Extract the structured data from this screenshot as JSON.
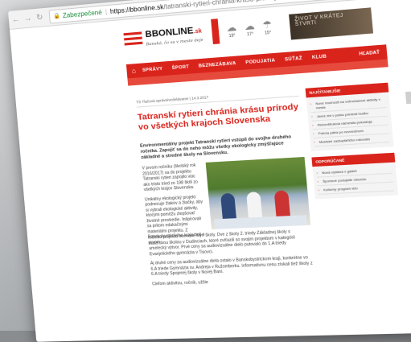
{
  "browser": {
    "secure_label": "Zabezpečené",
    "url_host": "https://bbonline.sk",
    "url_path": "/tatranski-rytieri-chrania-krasu-prirody-vo-vsetkych-krajoch-slovenska/"
  },
  "site": {
    "logo_main": "BBONLINE",
    "logo_suffix": ".sk",
    "tagline": "Banská, čo sa v meste deje",
    "banner_text": "ŽIVOT V KRÁTEJ ŠTVRTI",
    "weather": [
      {
        "icon": "cloud-sun-icon",
        "temp": "19°"
      },
      {
        "icon": "cloud-icon",
        "temp": "17°"
      },
      {
        "icon": "rain-icon",
        "temp": "15°"
      }
    ]
  },
  "nav": {
    "items": [
      "SPRÁVY",
      "ŠPORT",
      "BEZNEZÁBAVA",
      "PODUJATIA",
      "SÚŤAŽ",
      "KLUB"
    ],
    "search_label": "HĽADAŤ"
  },
  "article": {
    "breadcrumb": "TS Tlačová správa/vzdelávanie | 14.3.2017",
    "title": "Tatranskí rytieri chránia krásu prírody vo všetkých krajoch Slovenska",
    "lead": "Environmentálny projekt Tatranskí rytieri vstúpil do svojho druhého ročníka. Zapojiť sa do neho môžu všetky ekologicky zmýšľajúce základné a stredné školy na Slovensku.",
    "p1": "V prvom ročníku (školský rok 2016/2017) sa do projektu Tatranskí rytieri zapojilo viac ako tristo tried zo 198 škôl zo všetkých krajov Slovenska.",
    "p2": "Unikátny ekologický projekt podnecuje žiakov a žiačky, aby si vybrali ekologické aktivity, ktorými pomôžu zlepšovať životné prostredie. Inšpirovali sa pritom edukačnými materiálmi projektu. Z Banskobystrického kraja boli v prvom",
    "p3": "ročníku projektu ocenené štyri školy. Dve z školy 2. triedy Základnej školy s materskou školou v Dudinciach, ktoré zvíťazili so svojim projektom v kategórii umelecký výtvor. Prvé ceny sa audiovizuálne dielo putovalo do 1.A triedy Evanjelického gymnázia v Tisovci.",
    "p4": "Aj druhé ceny za audiovizuálne diela ostalo v Banskobystrickom kraji, konkrétne vo 6.A triede Gymnázia sv. Andreja v Ružomberku. Informatívnu cenu získali tiež školy z 6.A triedy Spojenej školy v Novej Bani.",
    "p5": "Cieľom aktivitou, ročník, užšie"
  },
  "sidebar": {
    "box1_title": "NAJČÍTANEJŠIE",
    "box1_items": [
      "Nové možnosti na voľnočasové aktivity v meste",
      "Jarné dni v parku priniesli hudbu",
      "Rekonštrukcia námestia pokračuje",
      "Polícia pátra po nezvestnom",
      "Mestské zastupiteľstvo rokovalo"
    ],
    "box2_title": "ODPORÚČANÉ",
    "box2_items": [
      "Nová výstava v galérii",
      "Športové podujatie víkendu",
      "Kultúrny program leto"
    ]
  }
}
